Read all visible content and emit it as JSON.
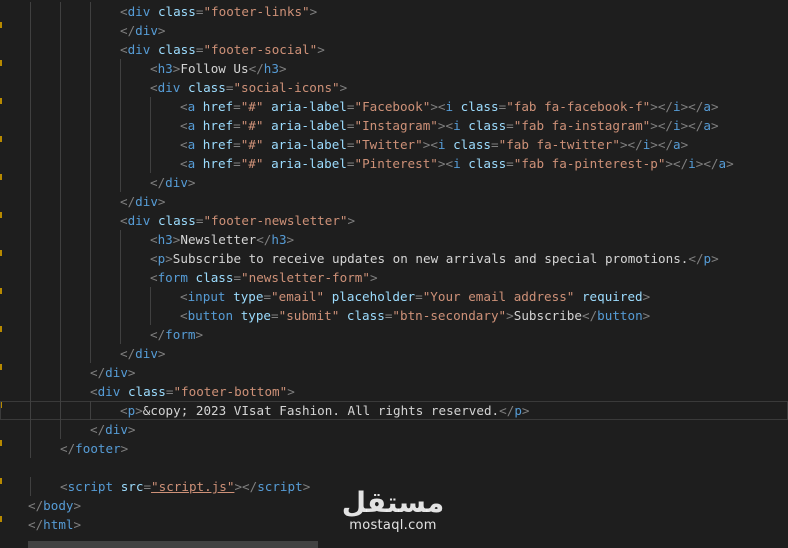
{
  "editor": {
    "lines": [
      [
        [
          "p",
          "<"
        ],
        [
          "t",
          "div"
        ],
        [
          "x",
          " "
        ],
        [
          "a",
          "class"
        ],
        [
          "p",
          "="
        ],
        [
          "s",
          "\"footer-links\""
        ],
        [
          "p",
          ">"
        ]
      ],
      [
        [
          "p",
          "</"
        ],
        [
          "t",
          "div"
        ],
        [
          "p",
          ">"
        ]
      ],
      [
        [
          "p",
          "<"
        ],
        [
          "t",
          "div"
        ],
        [
          "x",
          " "
        ],
        [
          "a",
          "class"
        ],
        [
          "p",
          "="
        ],
        [
          "s",
          "\"footer-social\""
        ],
        [
          "p",
          ">"
        ]
      ],
      [
        [
          "p",
          "<"
        ],
        [
          "t",
          "h3"
        ],
        [
          "p",
          ">"
        ],
        [
          "x",
          "Follow Us"
        ],
        [
          "p",
          "</"
        ],
        [
          "t",
          "h3"
        ],
        [
          "p",
          ">"
        ]
      ],
      [
        [
          "p",
          "<"
        ],
        [
          "t",
          "div"
        ],
        [
          "x",
          " "
        ],
        [
          "a",
          "class"
        ],
        [
          "p",
          "="
        ],
        [
          "s",
          "\"social-icons\""
        ],
        [
          "p",
          ">"
        ]
      ],
      [
        [
          "p",
          "<"
        ],
        [
          "t",
          "a"
        ],
        [
          "x",
          " "
        ],
        [
          "a",
          "href"
        ],
        [
          "p",
          "="
        ],
        [
          "s",
          "\"#\""
        ],
        [
          "x",
          " "
        ],
        [
          "a",
          "aria-label"
        ],
        [
          "p",
          "="
        ],
        [
          "s",
          "\"Facebook\""
        ],
        [
          "p",
          "><"
        ],
        [
          "t",
          "i"
        ],
        [
          "x",
          " "
        ],
        [
          "a",
          "class"
        ],
        [
          "p",
          "="
        ],
        [
          "s",
          "\"fab fa-facebook-f\""
        ],
        [
          "p",
          "></"
        ],
        [
          "t",
          "i"
        ],
        [
          "p",
          "></"
        ],
        [
          "t",
          "a"
        ],
        [
          "p",
          ">"
        ]
      ],
      [
        [
          "p",
          "<"
        ],
        [
          "t",
          "a"
        ],
        [
          "x",
          " "
        ],
        [
          "a",
          "href"
        ],
        [
          "p",
          "="
        ],
        [
          "s",
          "\"#\""
        ],
        [
          "x",
          " "
        ],
        [
          "a",
          "aria-label"
        ],
        [
          "p",
          "="
        ],
        [
          "s",
          "\"Instagram\""
        ],
        [
          "p",
          "><"
        ],
        [
          "t",
          "i"
        ],
        [
          "x",
          " "
        ],
        [
          "a",
          "class"
        ],
        [
          "p",
          "="
        ],
        [
          "s",
          "\"fab fa-instagram\""
        ],
        [
          "p",
          "></"
        ],
        [
          "t",
          "i"
        ],
        [
          "p",
          "></"
        ],
        [
          "t",
          "a"
        ],
        [
          "p",
          ">"
        ]
      ],
      [
        [
          "p",
          "<"
        ],
        [
          "t",
          "a"
        ],
        [
          "x",
          " "
        ],
        [
          "a",
          "href"
        ],
        [
          "p",
          "="
        ],
        [
          "s",
          "\"#\""
        ],
        [
          "x",
          " "
        ],
        [
          "a",
          "aria-label"
        ],
        [
          "p",
          "="
        ],
        [
          "s",
          "\"Twitter\""
        ],
        [
          "p",
          "><"
        ],
        [
          "t",
          "i"
        ],
        [
          "x",
          " "
        ],
        [
          "a",
          "class"
        ],
        [
          "p",
          "="
        ],
        [
          "s",
          "\"fab fa-twitter\""
        ],
        [
          "p",
          "></"
        ],
        [
          "t",
          "i"
        ],
        [
          "p",
          "></"
        ],
        [
          "t",
          "a"
        ],
        [
          "p",
          ">"
        ]
      ],
      [
        [
          "p",
          "<"
        ],
        [
          "t",
          "a"
        ],
        [
          "x",
          " "
        ],
        [
          "a",
          "href"
        ],
        [
          "p",
          "="
        ],
        [
          "s",
          "\"#\""
        ],
        [
          "x",
          " "
        ],
        [
          "a",
          "aria-label"
        ],
        [
          "p",
          "="
        ],
        [
          "s",
          "\"Pinterest\""
        ],
        [
          "p",
          "><"
        ],
        [
          "t",
          "i"
        ],
        [
          "x",
          " "
        ],
        [
          "a",
          "class"
        ],
        [
          "p",
          "="
        ],
        [
          "s",
          "\"fab fa-pinterest-p\""
        ],
        [
          "p",
          "></"
        ],
        [
          "t",
          "i"
        ],
        [
          "p",
          "></"
        ],
        [
          "t",
          "a"
        ],
        [
          "p",
          ">"
        ]
      ],
      [
        [
          "p",
          "</"
        ],
        [
          "t",
          "div"
        ],
        [
          "p",
          ">"
        ]
      ],
      [
        [
          "p",
          "</"
        ],
        [
          "t",
          "div"
        ],
        [
          "p",
          ">"
        ]
      ],
      [
        [
          "p",
          "<"
        ],
        [
          "t",
          "div"
        ],
        [
          "x",
          " "
        ],
        [
          "a",
          "class"
        ],
        [
          "p",
          "="
        ],
        [
          "s",
          "\"footer-newsletter\""
        ],
        [
          "p",
          ">"
        ]
      ],
      [
        [
          "p",
          "<"
        ],
        [
          "t",
          "h3"
        ],
        [
          "p",
          ">"
        ],
        [
          "x",
          "Newsletter"
        ],
        [
          "p",
          "</"
        ],
        [
          "t",
          "h3"
        ],
        [
          "p",
          ">"
        ]
      ],
      [
        [
          "p",
          "<"
        ],
        [
          "t",
          "p"
        ],
        [
          "p",
          ">"
        ],
        [
          "x",
          "Subscribe to receive updates on new arrivals and special promotions."
        ],
        [
          "p",
          "</"
        ],
        [
          "t",
          "p"
        ],
        [
          "p",
          ">"
        ]
      ],
      [
        [
          "p",
          "<"
        ],
        [
          "t",
          "form"
        ],
        [
          "x",
          " "
        ],
        [
          "a",
          "class"
        ],
        [
          "p",
          "="
        ],
        [
          "s",
          "\"newsletter-form\""
        ],
        [
          "p",
          ">"
        ]
      ],
      [
        [
          "p",
          "<"
        ],
        [
          "t",
          "input"
        ],
        [
          "x",
          " "
        ],
        [
          "a",
          "type"
        ],
        [
          "p",
          "="
        ],
        [
          "s",
          "\"email\""
        ],
        [
          "x",
          " "
        ],
        [
          "a",
          "placeholder"
        ],
        [
          "p",
          "="
        ],
        [
          "s",
          "\"Your email address\""
        ],
        [
          "x",
          " "
        ],
        [
          "a",
          "required"
        ],
        [
          "p",
          ">"
        ]
      ],
      [
        [
          "p",
          "<"
        ],
        [
          "t",
          "button"
        ],
        [
          "x",
          " "
        ],
        [
          "a",
          "type"
        ],
        [
          "p",
          "="
        ],
        [
          "s",
          "\"submit\""
        ],
        [
          "x",
          " "
        ],
        [
          "a",
          "class"
        ],
        [
          "p",
          "="
        ],
        [
          "s",
          "\"btn-secondary\""
        ],
        [
          "p",
          ">"
        ],
        [
          "x",
          "Subscribe"
        ],
        [
          "p",
          "</"
        ],
        [
          "t",
          "button"
        ],
        [
          "p",
          ">"
        ]
      ],
      [
        [
          "p",
          "</"
        ],
        [
          "t",
          "form"
        ],
        [
          "p",
          ">"
        ]
      ],
      [
        [
          "p",
          "</"
        ],
        [
          "t",
          "div"
        ],
        [
          "p",
          ">"
        ]
      ],
      [
        [
          "p",
          "</"
        ],
        [
          "t",
          "div"
        ],
        [
          "p",
          ">"
        ]
      ],
      [
        [
          "p",
          "<"
        ],
        [
          "t",
          "div"
        ],
        [
          "x",
          " "
        ],
        [
          "a",
          "class"
        ],
        [
          "p",
          "="
        ],
        [
          "s",
          "\"footer-bottom\""
        ],
        [
          "p",
          ">"
        ]
      ],
      [
        [
          "p",
          "<"
        ],
        [
          "t",
          "p"
        ],
        [
          "p",
          ">"
        ],
        [
          "x",
          "&copy; 2023 VIsat Fashion. All rights reserved."
        ],
        [
          "p",
          "</"
        ],
        [
          "t",
          "p"
        ],
        [
          "p",
          ">"
        ]
      ],
      [
        [
          "p",
          "</"
        ],
        [
          "t",
          "div"
        ],
        [
          "p",
          ">"
        ]
      ],
      [
        [
          "p",
          "</"
        ],
        [
          "t",
          "footer"
        ],
        [
          "p",
          ">"
        ]
      ],
      [],
      [
        [
          "p",
          "<"
        ],
        [
          "t",
          "script"
        ],
        [
          "x",
          " "
        ],
        [
          "a",
          "src"
        ],
        [
          "p",
          "="
        ],
        [
          "su",
          "\"script.js\""
        ],
        [
          "p",
          "></"
        ],
        [
          "t",
          "script"
        ],
        [
          "p",
          ">"
        ]
      ],
      [
        [
          "p",
          "</"
        ],
        [
          "t",
          "body"
        ],
        [
          "p",
          ">"
        ]
      ],
      [
        [
          "p",
          "</"
        ],
        [
          "t",
          "html"
        ],
        [
          "p",
          ">"
        ]
      ]
    ]
  },
  "watermark": {
    "arabic": "مستقل",
    "latin": "mostaql.com"
  },
  "colors": {
    "background": "#1e1e1e",
    "tag": "#569cd6",
    "attribute": "#9cdcfe",
    "string": "#ce9178",
    "punctuation": "#808080",
    "text": "#d4d4d4"
  }
}
